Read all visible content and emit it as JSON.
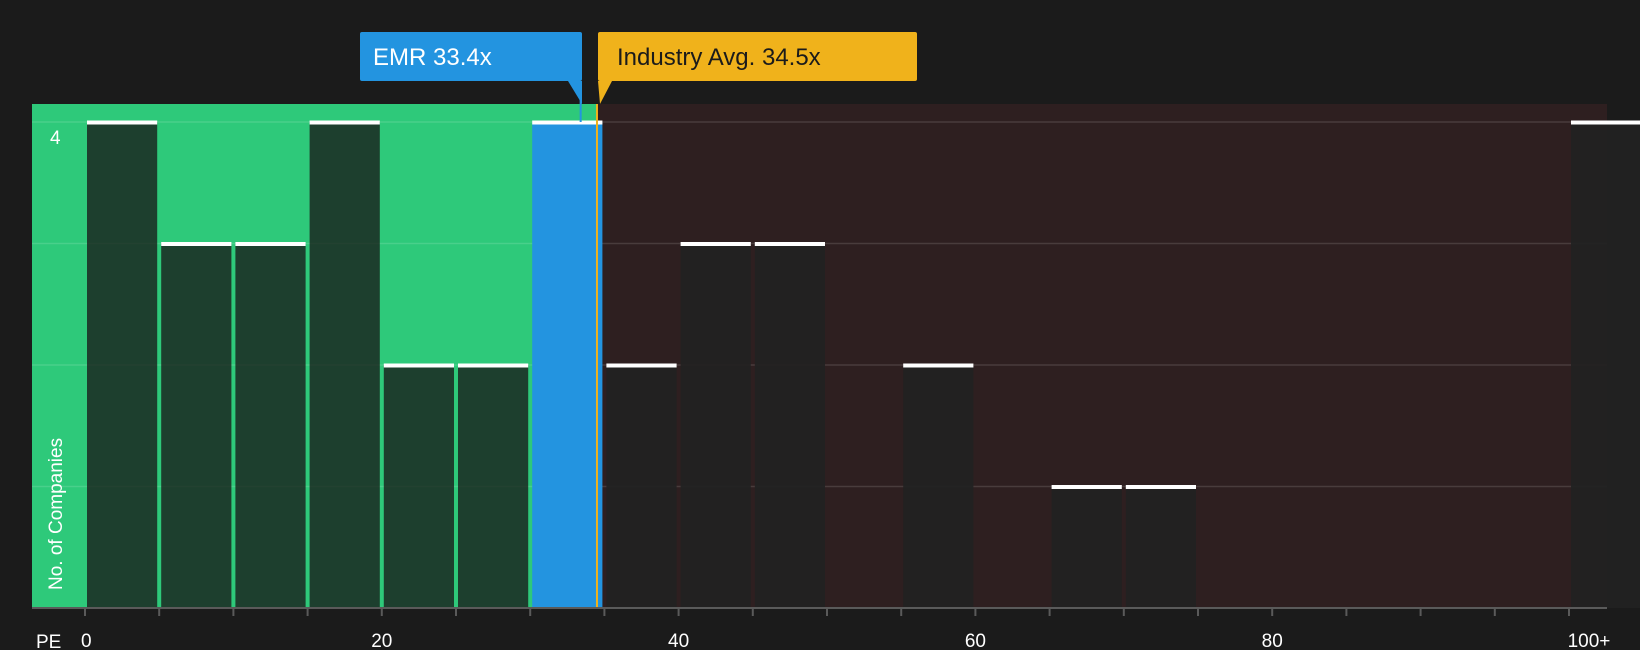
{
  "chart_data": {
    "type": "bar",
    "x_axis_label": "PE",
    "y_axis_label": "No. of Companies",
    "x_ticks": [
      "0",
      "20",
      "40",
      "60",
      "80",
      "100+"
    ],
    "y_ticks": [
      "4"
    ],
    "x_range": [
      0,
      100
    ],
    "y_range": [
      0,
      4
    ],
    "bin_width": 5,
    "bins": [
      {
        "x_start": 0,
        "x_end": 5,
        "count": 4
      },
      {
        "x_start": 5,
        "x_end": 10,
        "count": 3
      },
      {
        "x_start": 10,
        "x_end": 15,
        "count": 3
      },
      {
        "x_start": 15,
        "x_end": 20,
        "count": 4
      },
      {
        "x_start": 20,
        "x_end": 25,
        "count": 2
      },
      {
        "x_start": 25,
        "x_end": 30,
        "count": 2
      },
      {
        "x_start": 30,
        "x_end": 35,
        "count": 4,
        "highlight": true
      },
      {
        "x_start": 35,
        "x_end": 40,
        "count": 2
      },
      {
        "x_start": 40,
        "x_end": 45,
        "count": 3
      },
      {
        "x_start": 45,
        "x_end": 50,
        "count": 3
      },
      {
        "x_start": 55,
        "x_end": 60,
        "count": 2
      },
      {
        "x_start": 65,
        "x_end": 70,
        "count": 1
      },
      {
        "x_start": 70,
        "x_end": 75,
        "count": 1
      },
      {
        "x_start": 100,
        "x_end": 105,
        "count": 4
      }
    ],
    "markers": {
      "company": {
        "label": "EMR 33.4x",
        "value": 33.4,
        "color": "#2394e0"
      },
      "industry": {
        "label": "Industry Avg. 34.5x",
        "value": 34.5,
        "color": "#f0b21b"
      }
    },
    "zones": {
      "undervalued_color": "#2ec97a",
      "overvalued_color": "#2e1f20"
    },
    "grid": true
  }
}
